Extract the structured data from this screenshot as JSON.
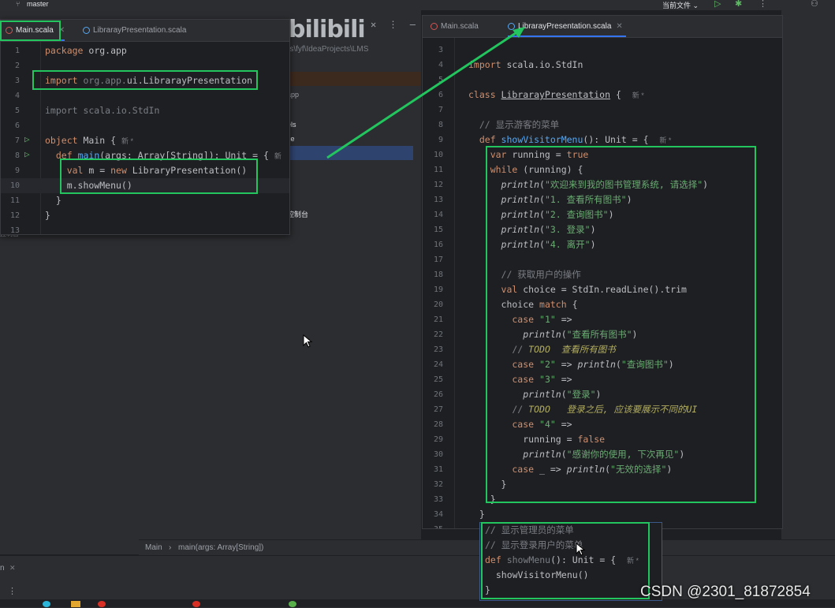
{
  "topbar": {
    "branch": "master",
    "run_config": "当前文件 ⌄"
  },
  "bg_ide": {
    "path_text": "rs\\fyf\\IdeaProjects\\LMS",
    "tree_items": [
      "app",
      "els",
      "ce",
      "控制台"
    ],
    "left_frag": "控制台",
    "status_breadcrumb": [
      "Main",
      "main(args: Array[String])"
    ],
    "bottom_tab": "n"
  },
  "watermark": {
    "logo": "bilibili",
    "credit": "CSDN @2301_81872854"
  },
  "editor_main": {
    "tabs": [
      {
        "label": "Main.scala",
        "active": true
      },
      {
        "label": "LibrarayPresentation.scala",
        "active": false
      }
    ],
    "lines": [
      {
        "n": "1",
        "tokens": [
          {
            "t": "package ",
            "c": "kw"
          },
          {
            "t": "org.app",
            "c": ""
          }
        ]
      },
      {
        "n": "2",
        "tokens": []
      },
      {
        "n": "3",
        "tokens": [
          {
            "t": "import ",
            "c": "kw"
          },
          {
            "t": "org.app.",
            "c": "dim"
          },
          {
            "t": "ui.LibrarayPresentation",
            "c": ""
          }
        ]
      },
      {
        "n": "4",
        "tokens": []
      },
      {
        "n": "5",
        "tokens": [
          {
            "t": "import scala.io.StdIn",
            "c": "dim"
          }
        ]
      },
      {
        "n": "6",
        "tokens": []
      },
      {
        "n": "7",
        "tokens": [
          {
            "t": "object ",
            "c": "kw"
          },
          {
            "t": "Main { ",
            "c": ""
          },
          {
            "t": "新 *",
            "c": "nb"
          }
        ]
      },
      {
        "n": "8",
        "tokens": [
          {
            "t": "  def ",
            "c": "kw"
          },
          {
            "t": "main",
            "c": "fn"
          },
          {
            "t": "(args: Array[String]): Unit = { ",
            "c": ""
          },
          {
            "t": "新",
            "c": "nb"
          }
        ]
      },
      {
        "n": "9",
        "tokens": [
          {
            "t": "    val ",
            "c": "kw"
          },
          {
            "t": "m = ",
            "c": ""
          },
          {
            "t": "new ",
            "c": "kw"
          },
          {
            "t": "LibraryPresentation()",
            "c": ""
          }
        ]
      },
      {
        "n": "10",
        "tokens": [
          {
            "t": "    m.showMenu()",
            "c": ""
          }
        ]
      },
      {
        "n": "11",
        "tokens": [
          {
            "t": "  }",
            "c": ""
          }
        ]
      },
      {
        "n": "12",
        "tokens": [
          {
            "t": "}",
            "c": ""
          }
        ]
      },
      {
        "n": "13",
        "tokens": []
      }
    ]
  },
  "editor_lib": {
    "tabs": [
      {
        "label": "Main.scala",
        "active": false
      },
      {
        "label": "LibrarayPresentation.scala",
        "active": true
      }
    ],
    "lines": [
      {
        "n": "3",
        "tokens": []
      },
      {
        "n": "4",
        "tokens": [
          {
            "t": "import ",
            "c": "kw"
          },
          {
            "t": "scala.io.StdIn",
            "c": ""
          }
        ]
      },
      {
        "n": "5",
        "tokens": []
      },
      {
        "n": "6",
        "tokens": [
          {
            "t": "class ",
            "c": "kw"
          },
          {
            "t": "LibrarayPresentation",
            "c": "ty"
          },
          {
            "t": " {  ",
            "c": ""
          },
          {
            "t": "新 *",
            "c": "nb"
          }
        ]
      },
      {
        "n": "7",
        "tokens": []
      },
      {
        "n": "8",
        "tokens": [
          {
            "t": "  // 显示游客的菜单",
            "c": "cm"
          }
        ]
      },
      {
        "n": "9",
        "tokens": [
          {
            "t": "  def ",
            "c": "kw"
          },
          {
            "t": "showVisitorMenu",
            "c": "fn"
          },
          {
            "t": "(): Unit = {  ",
            "c": ""
          },
          {
            "t": "新 *",
            "c": "nb"
          }
        ]
      },
      {
        "n": "10",
        "tokens": [
          {
            "t": "    var ",
            "c": "kw"
          },
          {
            "t": "running = ",
            "c": ""
          },
          {
            "t": "true",
            "c": "kw"
          }
        ]
      },
      {
        "n": "11",
        "tokens": [
          {
            "t": "    while ",
            "c": "kw"
          },
          {
            "t": "(running) {",
            "c": ""
          }
        ]
      },
      {
        "n": "12",
        "tokens": [
          {
            "t": "      ",
            "c": ""
          },
          {
            "t": "println",
            "c": "it"
          },
          {
            "t": "(",
            "c": ""
          },
          {
            "t": "\"欢迎来到我的图书管理系统, 请选择\"",
            "c": "st"
          },
          {
            "t": ")",
            "c": ""
          }
        ]
      },
      {
        "n": "13",
        "tokens": [
          {
            "t": "      ",
            "c": ""
          },
          {
            "t": "println",
            "c": "it"
          },
          {
            "t": "(",
            "c": ""
          },
          {
            "t": "\"1. 查看所有图书\"",
            "c": "st"
          },
          {
            "t": ")",
            "c": ""
          }
        ]
      },
      {
        "n": "14",
        "tokens": [
          {
            "t": "      ",
            "c": ""
          },
          {
            "t": "println",
            "c": "it"
          },
          {
            "t": "(",
            "c": ""
          },
          {
            "t": "\"2. 查询图书\"",
            "c": "st"
          },
          {
            "t": ")",
            "c": ""
          }
        ]
      },
      {
        "n": "15",
        "tokens": [
          {
            "t": "      ",
            "c": ""
          },
          {
            "t": "println",
            "c": "it"
          },
          {
            "t": "(",
            "c": ""
          },
          {
            "t": "\"3. 登录\"",
            "c": "st"
          },
          {
            "t": ")",
            "c": ""
          }
        ]
      },
      {
        "n": "16",
        "tokens": [
          {
            "t": "      ",
            "c": ""
          },
          {
            "t": "println",
            "c": "it"
          },
          {
            "t": "(",
            "c": ""
          },
          {
            "t": "\"4. 离开\"",
            "c": "st"
          },
          {
            "t": ")",
            "c": ""
          }
        ]
      },
      {
        "n": "17",
        "tokens": []
      },
      {
        "n": "18",
        "tokens": [
          {
            "t": "      // 获取用户的操作",
            "c": "cm"
          }
        ]
      },
      {
        "n": "19",
        "tokens": [
          {
            "t": "      val ",
            "c": "kw"
          },
          {
            "t": "choice = StdIn.readLine().trim",
            "c": ""
          }
        ]
      },
      {
        "n": "20",
        "tokens": [
          {
            "t": "      choice ",
            "c": ""
          },
          {
            "t": "match ",
            "c": "kw"
          },
          {
            "t": "{",
            "c": ""
          }
        ]
      },
      {
        "n": "21",
        "tokens": [
          {
            "t": "        case ",
            "c": "kw"
          },
          {
            "t": "\"1\"",
            "c": "st"
          },
          {
            "t": " =>",
            "c": ""
          }
        ]
      },
      {
        "n": "22",
        "tokens": [
          {
            "t": "          ",
            "c": ""
          },
          {
            "t": "println",
            "c": "it"
          },
          {
            "t": "(",
            "c": ""
          },
          {
            "t": "\"查看所有图书\"",
            "c": "st"
          },
          {
            "t": ")",
            "c": ""
          }
        ]
      },
      {
        "n": "23",
        "tokens": [
          {
            "t": "        // ",
            "c": "cm"
          },
          {
            "t": "TODO  查看所有图书",
            "c": "td"
          }
        ]
      },
      {
        "n": "24",
        "tokens": [
          {
            "t": "        case ",
            "c": "kw"
          },
          {
            "t": "\"2\"",
            "c": "st"
          },
          {
            "t": " => ",
            "c": ""
          },
          {
            "t": "println",
            "c": "it"
          },
          {
            "t": "(",
            "c": ""
          },
          {
            "t": "\"查询图书\"",
            "c": "st"
          },
          {
            "t": ")",
            "c": ""
          }
        ]
      },
      {
        "n": "25",
        "tokens": [
          {
            "t": "        case ",
            "c": "kw"
          },
          {
            "t": "\"3\"",
            "c": "st"
          },
          {
            "t": " =>",
            "c": ""
          }
        ]
      },
      {
        "n": "26",
        "tokens": [
          {
            "t": "          ",
            "c": ""
          },
          {
            "t": "println",
            "c": "it"
          },
          {
            "t": "(",
            "c": ""
          },
          {
            "t": "\"登录\"",
            "c": "st"
          },
          {
            "t": ")",
            "c": ""
          }
        ]
      },
      {
        "n": "27",
        "tokens": [
          {
            "t": "        // ",
            "c": "cm"
          },
          {
            "t": "TODO   登录之后, 应该要展示不同的UI",
            "c": "td"
          }
        ]
      },
      {
        "n": "28",
        "tokens": [
          {
            "t": "        case ",
            "c": "kw"
          },
          {
            "t": "\"4\"",
            "c": "st"
          },
          {
            "t": " =>",
            "c": ""
          }
        ]
      },
      {
        "n": "29",
        "tokens": [
          {
            "t": "          running = ",
            "c": ""
          },
          {
            "t": "false",
            "c": "kw"
          }
        ]
      },
      {
        "n": "30",
        "tokens": [
          {
            "t": "          ",
            "c": ""
          },
          {
            "t": "println",
            "c": "it"
          },
          {
            "t": "(",
            "c": ""
          },
          {
            "t": "\"感谢你的使用, 下次再见\"",
            "c": "st"
          },
          {
            "t": ")",
            "c": ""
          }
        ]
      },
      {
        "n": "31",
        "tokens": [
          {
            "t": "        case ",
            "c": "kw"
          },
          {
            "t": "_ => ",
            "c": ""
          },
          {
            "t": "println",
            "c": "it"
          },
          {
            "t": "(",
            "c": ""
          },
          {
            "t": "\"无效的选择\"",
            "c": "st"
          },
          {
            "t": ")",
            "c": ""
          }
        ]
      },
      {
        "n": "32",
        "tokens": [
          {
            "t": "      }",
            "c": ""
          }
        ]
      },
      {
        "n": "33",
        "tokens": [
          {
            "t": "    }",
            "c": ""
          }
        ]
      },
      {
        "n": "34",
        "tokens": [
          {
            "t": "  }",
            "c": ""
          }
        ]
      },
      {
        "n": "35",
        "tokens": []
      }
    ]
  },
  "snippet": {
    "lines": [
      {
        "tokens": [
          {
            "t": "// 显示管理员的菜单",
            "c": "cm"
          }
        ]
      },
      {
        "tokens": [
          {
            "t": "// 显示登录用户的菜单",
            "c": "cm"
          }
        ]
      },
      {
        "tokens": [
          {
            "t": "def ",
            "c": "kw"
          },
          {
            "t": "showMenu",
            "c": "dim"
          },
          {
            "t": "(): Unit = {  ",
            "c": ""
          },
          {
            "t": "新 *",
            "c": "nb"
          }
        ]
      },
      {
        "tokens": [
          {
            "t": "  showVisitorMenu()",
            "c": ""
          }
        ]
      },
      {
        "tokens": [
          {
            "t": "}",
            "c": ""
          }
        ]
      }
    ]
  },
  "colors": {
    "annotation": "#22c55e",
    "bg": "#1e1f22",
    "panel": "#2b2d30"
  }
}
